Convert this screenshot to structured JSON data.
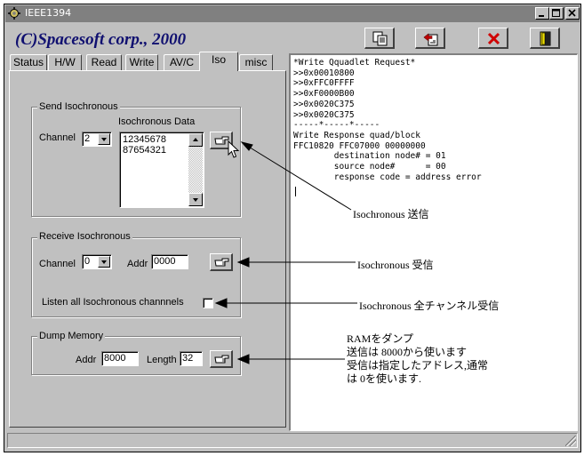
{
  "window": {
    "title": "IEEE1394",
    "brand": "(C)Spacesoft corp., 2000"
  },
  "tabs": [
    {
      "label": "Status"
    },
    {
      "label": "H/W"
    },
    {
      "label": "Read"
    },
    {
      "label": "Write"
    },
    {
      "label": "AV/C"
    },
    {
      "label": "Iso",
      "active": true
    },
    {
      "label": "misc"
    }
  ],
  "toolbar": [
    "copy-icon",
    "paste-icon",
    "delete-icon",
    "exit-icon"
  ],
  "send": {
    "group_title": "Send Isochronous",
    "channel_label": "Channel",
    "channel_value": "2",
    "data_label": "Isochronous Data",
    "data_lines": [
      "12345678",
      "87654321"
    ]
  },
  "receive": {
    "group_title": "Receive Isochronous",
    "channel_label": "Channel",
    "channel_value": "0",
    "addr_label": "Addr",
    "addr_value": "0000",
    "listen_label": "Listen all Isochronous channnels"
  },
  "dump": {
    "group_title": "Dump Memory",
    "addr_label": "Addr",
    "addr_value": "8000",
    "length_label": "Length",
    "length_value": "32"
  },
  "log_text": "*Write Qquadlet Request*\n>>0x00010800\n>>0xFFC0FFFF\n>>0xF0000B00\n>>0x0020C375\n>>0x0020C375\n-----*-----*-----\nWrite Response quad/block\nFFC10820 FFC07000 00000000\n        destination node# = 01\n        source node#      = 00\n        response code = address error",
  "annotations": {
    "send": "Isochronous 送信",
    "receive": "Isochronous 受信",
    "listen": "Isochronous 全チャンネル受信",
    "dump": [
      "RAMをダンプ",
      "送信は 8000から使います",
      "受信は指定したアドレス,通常",
      "は 0を使います."
    ]
  }
}
